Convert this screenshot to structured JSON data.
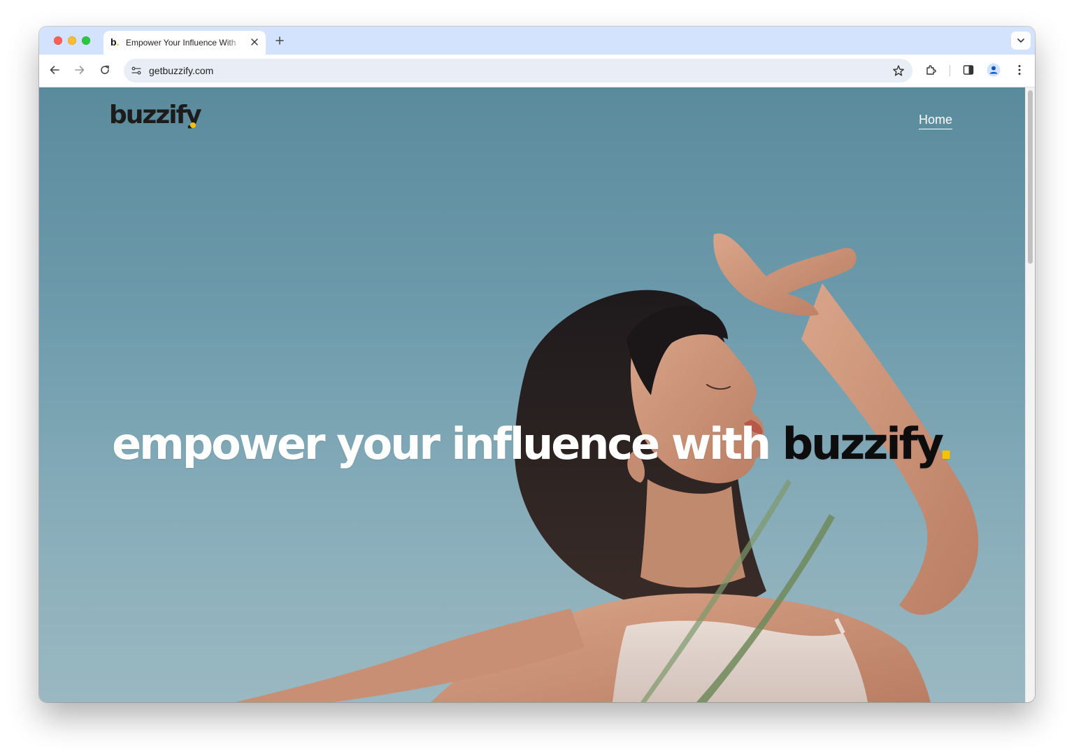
{
  "browser": {
    "tab_favicon_letter": "b",
    "tab_favicon_dot": ".",
    "tab_title": "Empower Your Influence With",
    "url": "getbuzzify.com"
  },
  "site": {
    "logo_text": "buzzify",
    "nav": {
      "home_label": "Home"
    },
    "hero": {
      "prefix": "empower your influence with",
      "brand": "buzzify",
      "dot": "."
    }
  },
  "colors": {
    "accent_yellow": "#f5c400",
    "tab_strip": "#d3e3fd",
    "omnibox": "#e9eef6"
  },
  "icons": [
    "close-icon",
    "plus-icon",
    "chevron-down-icon",
    "back-arrow-icon",
    "forward-arrow-icon",
    "reload-icon",
    "site-settings-icon",
    "star-icon",
    "extensions-icon",
    "side-panel-icon",
    "profile-icon",
    "kebab-menu-icon"
  ]
}
